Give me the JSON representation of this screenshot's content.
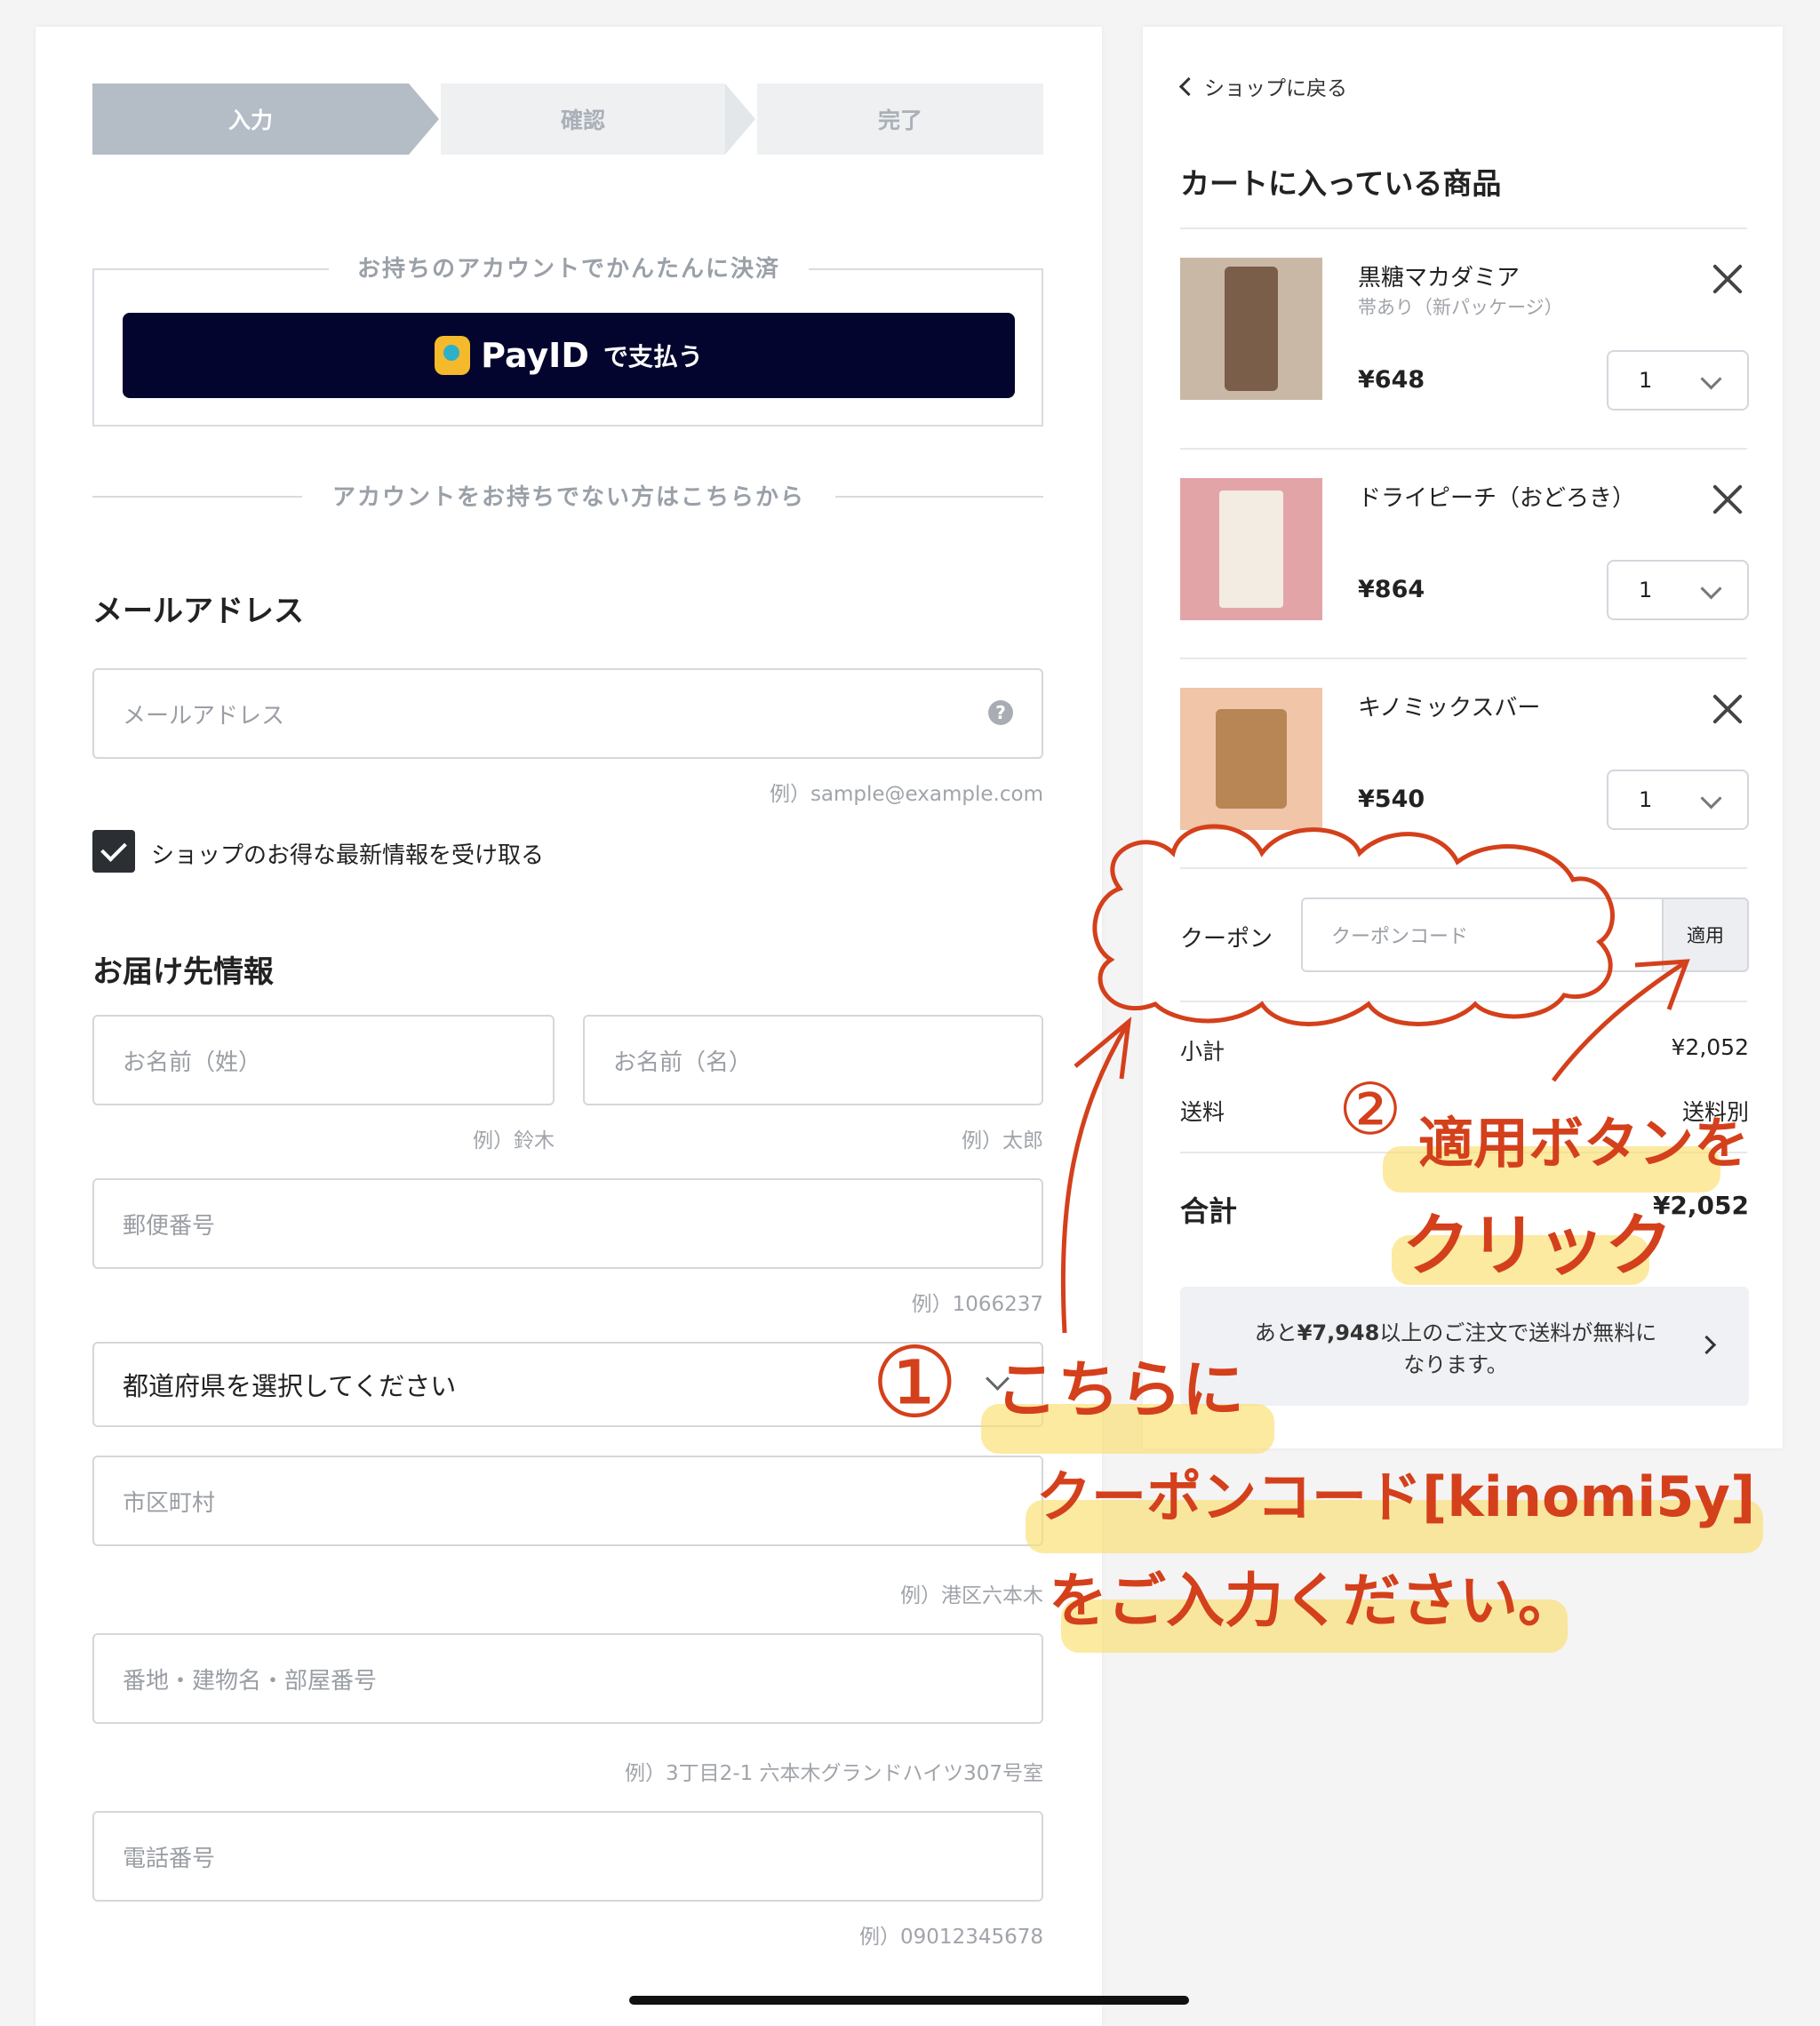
{
  "stepper": {
    "step1": "入力",
    "step2": "確認",
    "step3": "完了"
  },
  "payid": {
    "section_label": "お持ちのアカウントでかんたんに決済",
    "brand": "PayID",
    "suffix": "で支払う"
  },
  "no_account_label": "アカウントをお持ちでない方はこちらから",
  "email": {
    "title": "メールアドレス",
    "placeholder": "メールアドレス",
    "hint": "例）sample@example.com",
    "newsletter_label": "ショップのお得な最新情報を受け取る",
    "newsletter_checked": true
  },
  "shipping": {
    "title": "お届け先情報",
    "last_name_placeholder": "お名前（姓）",
    "last_name_hint": "例）鈴木",
    "first_name_placeholder": "お名前（名）",
    "first_name_hint": "例）太郎",
    "postal_placeholder": "郵便番号",
    "postal_hint": "例）1066237",
    "prefecture_value": "都道府県を選択してください",
    "city_placeholder": "市区町村",
    "city_hint": "例）港区六本木",
    "address_placeholder": "番地・建物名・部屋番号",
    "address_hint": "例）3丁目2-1 六本木グランドハイツ307号室",
    "phone_placeholder": "電話番号",
    "phone_hint": "例）09012345678"
  },
  "cart": {
    "back_link": "ショップに戻る",
    "title": "カートに入っている商品",
    "items": [
      {
        "name": "黒糖マカダミア",
        "variant": "帯あり（新パッケージ）",
        "price": "¥648",
        "qty": "1",
        "thumb_color": "#c9b8a6"
      },
      {
        "name": "ドライピーチ（おどろき）",
        "variant": "",
        "price": "¥864",
        "qty": "1",
        "thumb_color": "#e3a4a8"
      },
      {
        "name": "キノミックスバー",
        "variant": "",
        "price": "¥540",
        "qty": "1",
        "thumb_color": "#f0c5a8"
      }
    ],
    "coupon_label": "クーポン",
    "coupon_placeholder": "クーポンコード",
    "apply_label": "適用",
    "subtotal_label": "小計",
    "subtotal_value": "¥2,052",
    "shipping_label": "送料",
    "shipping_value": "送料別",
    "total_label": "合計",
    "total_value": "¥2,052",
    "free_ship_prefix": "あと",
    "free_ship_amount": "¥7,948",
    "free_ship_line1_suffix": "以上のご注文で送料が無料に",
    "free_ship_line2": "なります。"
  },
  "annotation": {
    "num1": "①",
    "line1": "こちらに",
    "line2": "クーポンコード[kinomi5y]",
    "line3": "をご入力ください。",
    "num2": "②",
    "note2_line1": "適用ボタンを",
    "note2_line2": "クリック",
    "color": "#d4401b",
    "highlight_color": "#fade6e"
  }
}
